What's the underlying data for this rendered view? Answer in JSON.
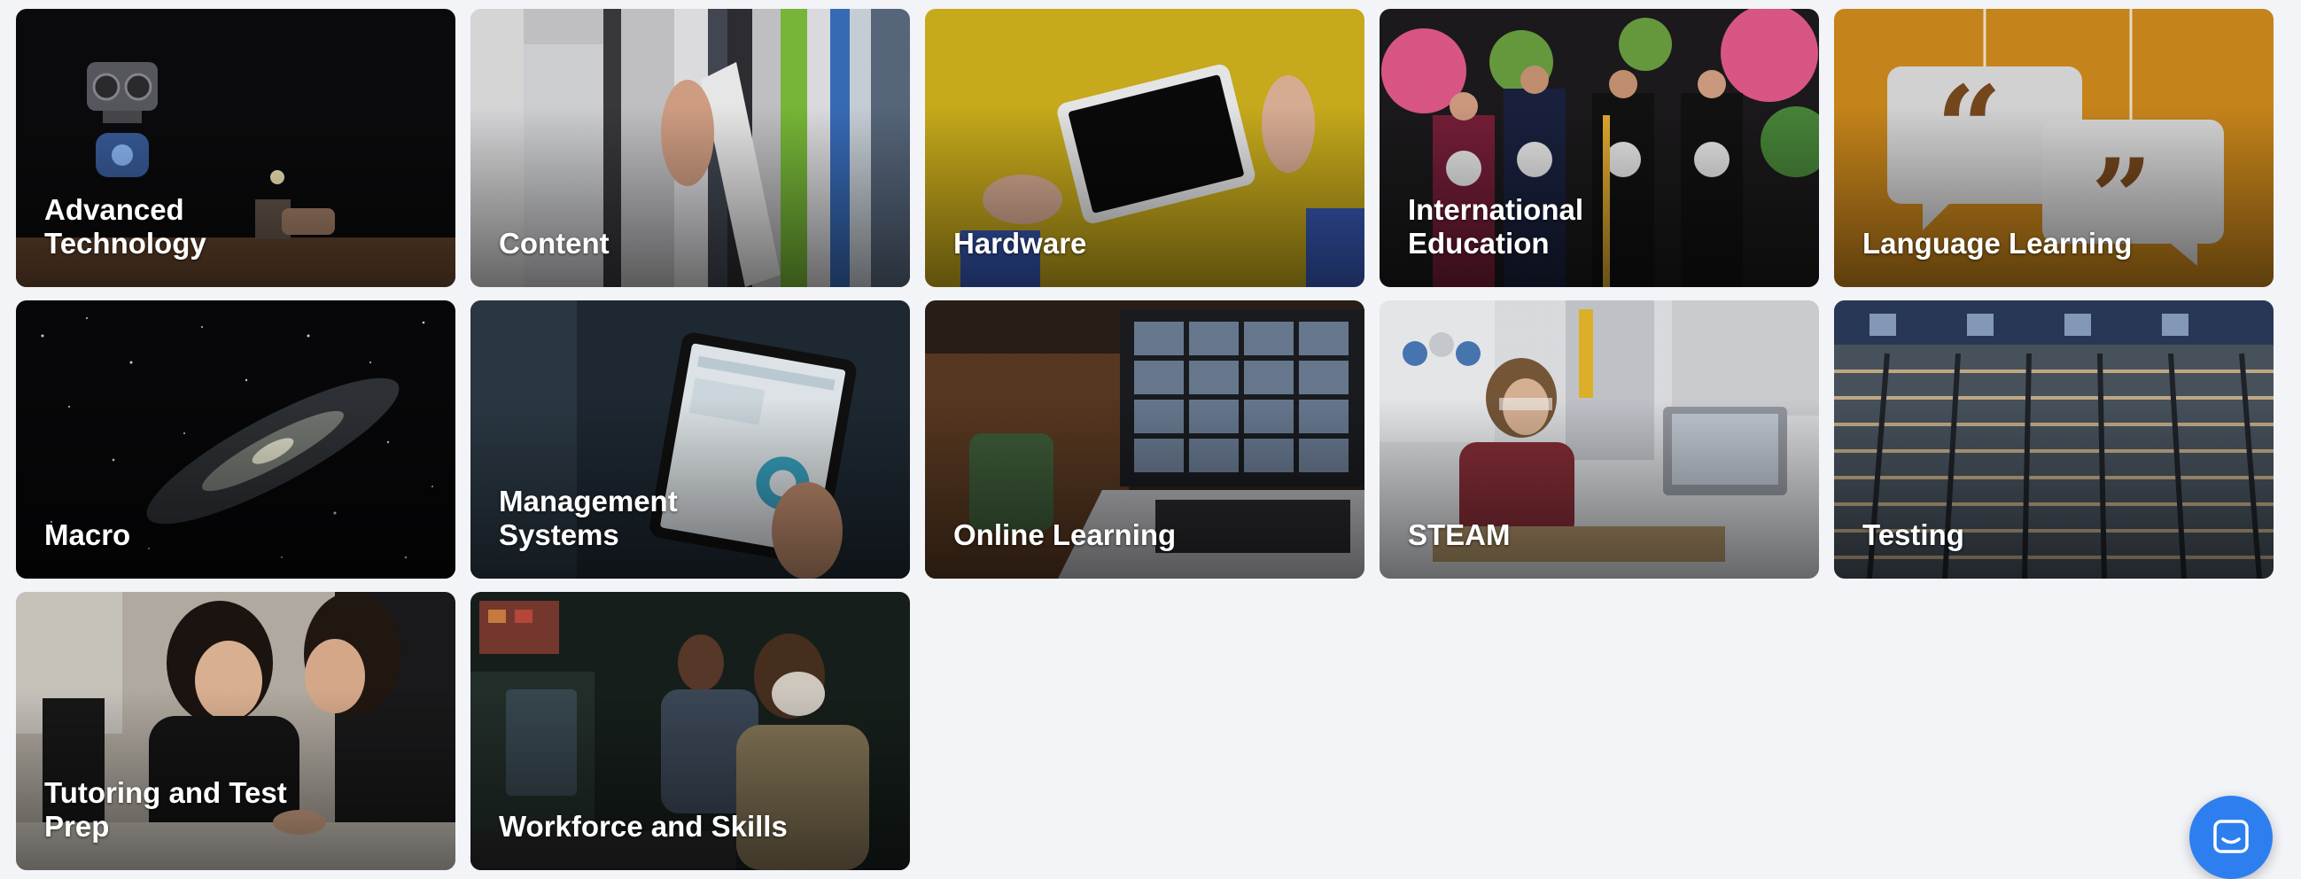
{
  "categories": [
    {
      "label": "Advanced\nTechnology",
      "scene": "robot-photo"
    },
    {
      "label": "Content",
      "scene": "bookshelf-photo"
    },
    {
      "label": "Hardware",
      "scene": "tablet-on-yellow-photo"
    },
    {
      "label": "International\nEducation",
      "scene": "graduates-photo"
    },
    {
      "label": "Language Learning",
      "scene": "quote-bubbles-photo"
    },
    {
      "label": "Macro",
      "scene": "galaxy-photo"
    },
    {
      "label": "Management\nSystems",
      "scene": "tablet-dashboard-photo"
    },
    {
      "label": "Online Learning",
      "scene": "video-call-laptop-photo"
    },
    {
      "label": "STEAM",
      "scene": "student-lab-photo"
    },
    {
      "label": "Testing",
      "scene": "exam-hall-photo"
    },
    {
      "label": "Tutoring and Test\nPrep",
      "scene": "tutoring-photo"
    },
    {
      "label": "Workforce and Skills",
      "scene": "workforce-photo"
    }
  ],
  "chat": {
    "icon": "chat-icon",
    "color": "#2d7ff0"
  },
  "colors": {
    "background": "#f3f4f8",
    "label_text": "#ffffff"
  }
}
